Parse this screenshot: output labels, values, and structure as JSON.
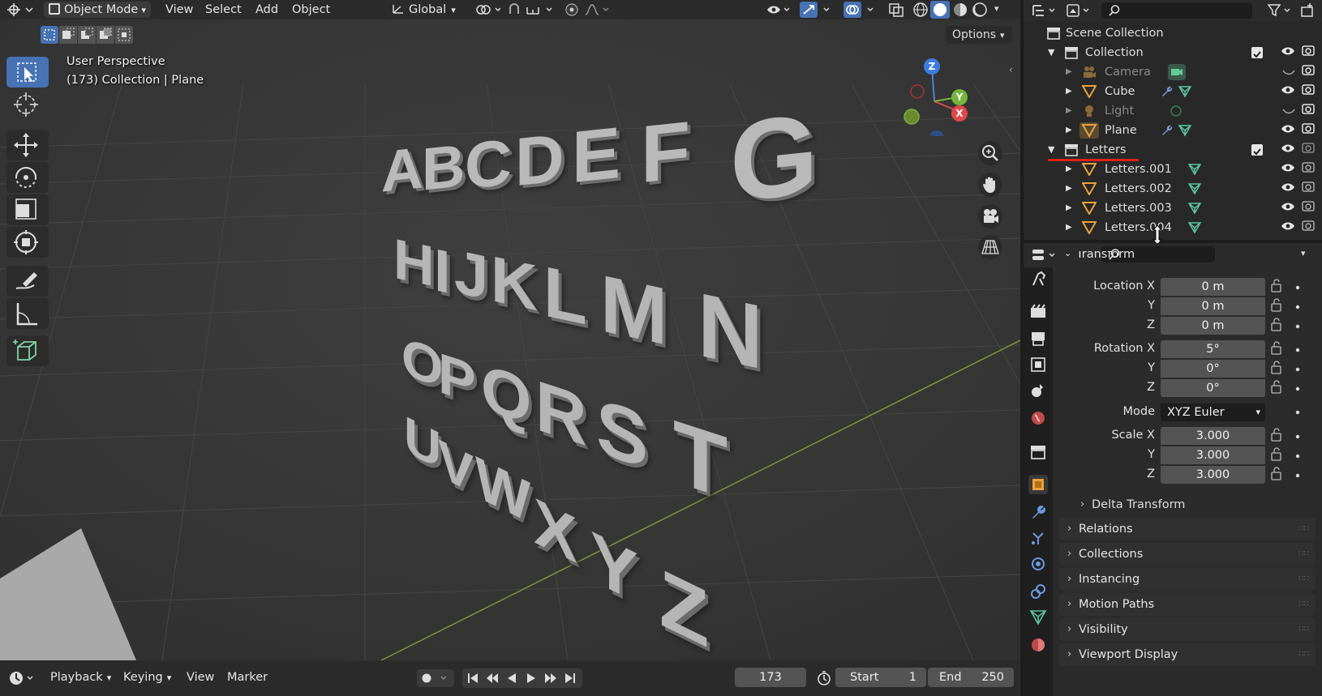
{
  "header": {
    "mode": "Object Mode",
    "menus": [
      "View",
      "Select",
      "Add",
      "Object"
    ],
    "transform_orientation": "Global",
    "options_label": "Options"
  },
  "viewport": {
    "title": "User Perspective",
    "subtitle": "(173) Collection | Plane",
    "letters_row1": [
      "A",
      "B",
      "C",
      "D",
      "E",
      "F",
      "G"
    ],
    "letters_row2": [
      "H",
      "I",
      "J",
      "K",
      "L",
      "M",
      "N"
    ],
    "letters_row3": [
      "O",
      "P",
      "Q",
      "R",
      "S",
      "T"
    ],
    "letters_row4": [
      "U",
      "V",
      "W",
      "X",
      "Y",
      "Z"
    ],
    "gizmo": {
      "z": "Z",
      "y": "Y",
      "x": "X"
    }
  },
  "timeline": {
    "menus": [
      "Playback",
      "Keying",
      "View",
      "Marker"
    ],
    "current_frame": "173",
    "start_label": "Start",
    "start_value": "1",
    "end_label": "End",
    "end_value": "250"
  },
  "outliner": {
    "root": "Scene Collection",
    "items": [
      {
        "name": "Collection"
      },
      {
        "name": "Camera"
      },
      {
        "name": "Cube"
      },
      {
        "name": "Light"
      },
      {
        "name": "Plane"
      },
      {
        "name": "Letters"
      },
      {
        "name": "Letters.001"
      },
      {
        "name": "Letters.002"
      },
      {
        "name": "Letters.003"
      },
      {
        "name": "Letters.004"
      }
    ]
  },
  "properties": {
    "transform_label": "Transform",
    "location_label": "Location X",
    "rotation_label": "Rotation X",
    "scale_label": "Scale X",
    "y_label": "Y",
    "z_label": "Z",
    "location": [
      "0 m",
      "0 m",
      "0 m"
    ],
    "rotation": [
      "5°",
      "0°",
      "0°"
    ],
    "mode_label": "Mode",
    "mode_value": "XYZ Euler",
    "scale": [
      "3.000",
      "3.000",
      "3.000"
    ],
    "delta_transform": "Delta Transform",
    "sections": [
      "Relations",
      "Collections",
      "Instancing",
      "Motion Paths",
      "Visibility",
      "Viewport Display"
    ]
  },
  "colors": {
    "accent": "#4772b3",
    "object_orange": "#e8a33b",
    "mesh_green": "#5bc3a3",
    "annotation_red": "#e0201a"
  }
}
